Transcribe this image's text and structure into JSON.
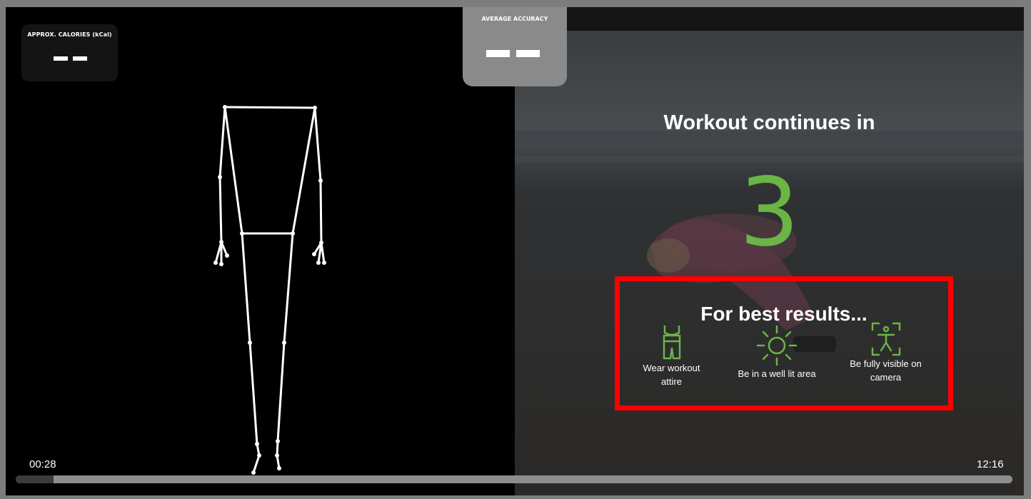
{
  "calories": {
    "label": "APPROX. CALORIES (kCal)",
    "value": "— —"
  },
  "accuracy": {
    "label": "AVERAGE ACCURACY",
    "value": "— —"
  },
  "countdown": {
    "title": "Workout continues in",
    "number": "3"
  },
  "tips": {
    "title": "For best results...",
    "items": [
      {
        "icon": "workout-attire-icon",
        "text_line1": "Wear workout",
        "text_line2": "attire"
      },
      {
        "icon": "sun-icon",
        "text_line1": "Be in a well lit area",
        "text_line2": ""
      },
      {
        "icon": "full-body-camera-icon",
        "text_line1": "Be fully visible on",
        "text_line2": "camera"
      }
    ]
  },
  "timeline": {
    "elapsed": "00:28",
    "total": "12:16",
    "progress_fraction": 0.038
  },
  "colors": {
    "accent_green": "#6ab545",
    "highlight_red": "#ff0000"
  }
}
